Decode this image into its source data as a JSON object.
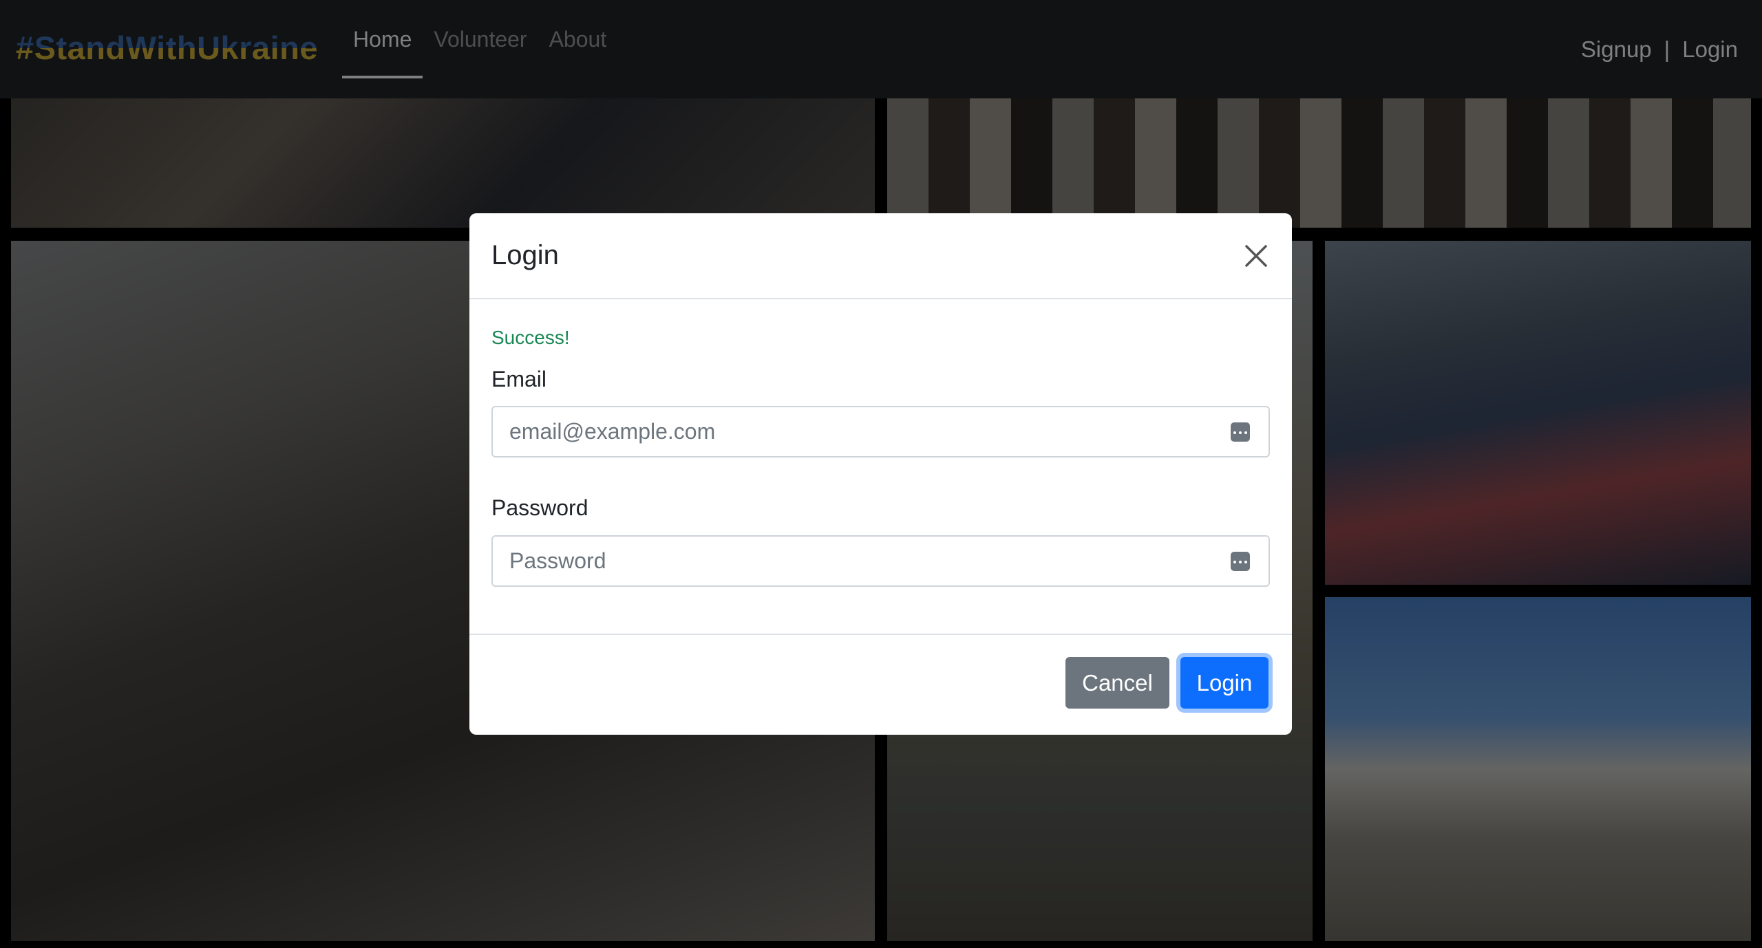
{
  "navbar": {
    "brand": "#StandWithUkraine",
    "links": [
      "Home",
      "Volunteer",
      "About"
    ],
    "active": "Home",
    "auth": {
      "signup": "Signup",
      "separator": "|",
      "login": "Login"
    }
  },
  "gallery": {
    "photos": [
      "refugees-walking",
      "destroyed-building",
      "bridge-evacuation",
      "soldiers",
      "metro-shelter",
      "city-ruins"
    ]
  },
  "modal": {
    "title": "Login",
    "close_icon": "close-icon",
    "success_message": "Success!",
    "email_label": "Email",
    "email_placeholder": "email@example.com",
    "email_value": "",
    "password_label": "Password",
    "password_placeholder": "Password",
    "password_value": "",
    "field_icon": "password-manager-icon",
    "cancel_label": "Cancel",
    "login_label": "Login"
  },
  "colors": {
    "navbar_bg": "#212529",
    "success": "#198754",
    "primary": "#0d6efd",
    "secondary": "#6c757d"
  }
}
